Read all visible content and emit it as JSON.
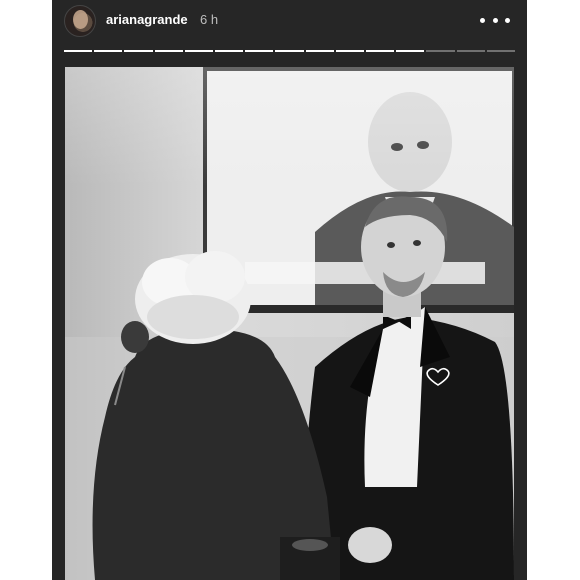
{
  "story": {
    "username": "arianagrande",
    "time": "6 h",
    "progress": {
      "total_segments": 15,
      "viewed_segments": 12
    }
  },
  "icons": {
    "more": "more-horizontal-icon"
  },
  "colors": {
    "background": "#262626",
    "text": "#ffffff",
    "muted": "#bdbdbd"
  }
}
